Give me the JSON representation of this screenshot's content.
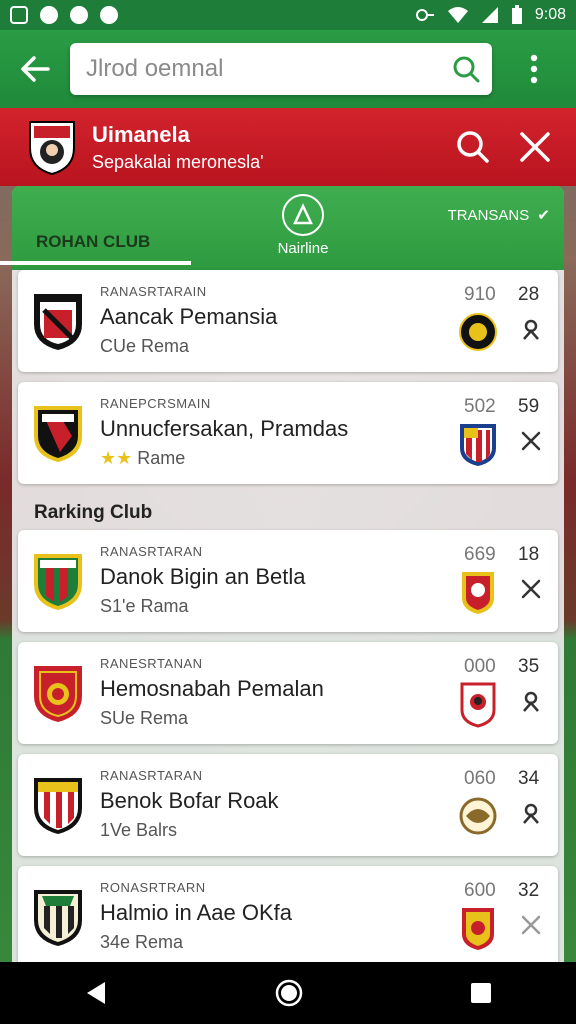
{
  "status": {
    "time": "9:08"
  },
  "app_bar": {
    "search_placeholder": "Jlrod oemnal"
  },
  "banner": {
    "title": "Uimanela",
    "subtitle": "Sepakalai meronesla'"
  },
  "tabs": {
    "club": "ROHAN CLUB",
    "center": "Nairline",
    "right": "TRANSANS"
  },
  "section_label": "Rarking Club",
  "cards": [
    {
      "category": "RANASRTARAIN",
      "name": "Aancak Pemansia",
      "sub": "CUe Rema",
      "num1": "910",
      "num2": "28",
      "action": "rank"
    },
    {
      "category": "RANEPCRSMAIN",
      "name": "Unnucfersakan, Pramdas",
      "sub": "Rame",
      "stars": "★★",
      "num1": "502",
      "num2": "59",
      "action": "close"
    },
    {
      "category": "RANASRTARAN",
      "name": "Danok Bigin an Betla",
      "sub": "S1'e Rama",
      "num1": "669",
      "num2": "18",
      "action": "close"
    },
    {
      "category": "RANESRTANAN",
      "name": "Hemosnabah Pemalan",
      "sub": "SUe Rema",
      "num1": "000",
      "num2": "35",
      "action": "rank"
    },
    {
      "category": "RANASRTARAN",
      "name": "Benok Bofar Roak",
      "sub": "1Ve Balrs",
      "num1": "060",
      "num2": "34",
      "action": "rank"
    },
    {
      "category": "RONASRTRARN",
      "name": "Halmio in Aae OKfa",
      "sub": "34e Rema",
      "num1": "600",
      "num2": "32",
      "action": "close"
    }
  ],
  "colors": {
    "green": "#2a9c44",
    "red": "#c8202a",
    "white": "#ffffff"
  }
}
